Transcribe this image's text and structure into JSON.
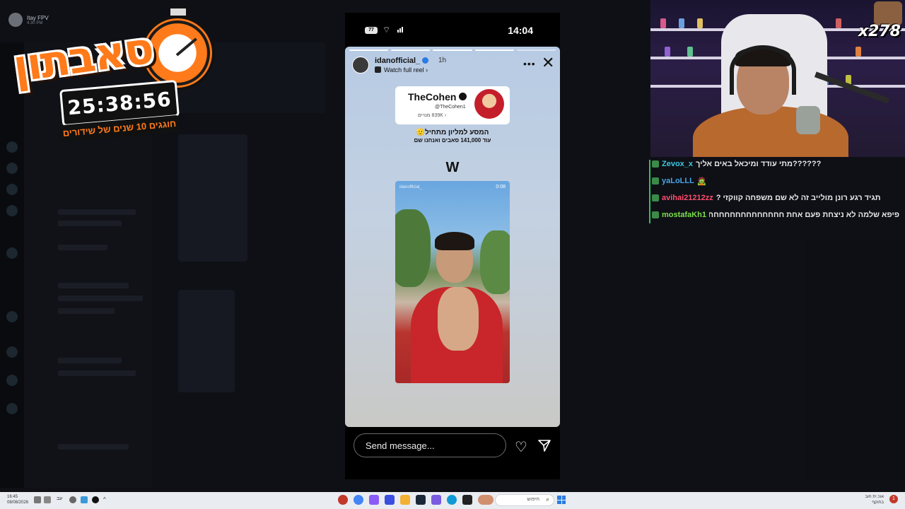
{
  "overlay": {
    "streamer_name": "Itay",
    "streamer_badge": "FPV",
    "streamer_sub": "4:30 PM",
    "logo_title": "סאבתון",
    "timer": "25:38:56",
    "logo_subtitle": "חוגגים 10 שנים של שידורים",
    "counter": "x278"
  },
  "phone": {
    "status": {
      "battery": "77",
      "clock": "14:04"
    },
    "story": {
      "username": "idanofficial_",
      "time_ago": "1h",
      "watch_reel": "Watch full reel ›",
      "card": {
        "name": "TheCohen",
        "handle": "@TheCohen1",
        "subs": "‹ 839K מנויים"
      },
      "line1": "המסע למליון מתחיל🫡",
      "line2": "עוד 141,000 סאבים ואנחנו שם",
      "big_letter": "W",
      "reel_user": "idanofficial_",
      "reel_time": "0:08"
    },
    "message_placeholder": "Send message..."
  },
  "chat": {
    "messages": [
      {
        "user": "Zevox_x",
        "color": "#3ec6e0",
        "text": "??????מתי עודד ומיכאל באים אליך"
      },
      {
        "user": "yaLoLLL",
        "color": "#4aa3e8",
        "text": "🧟"
      },
      {
        "user": "avihai21212zz",
        "color": "#ff4d6d",
        "text": "תגיד רגע רונן מולייב זה לא שם משפחה קווקזי ?"
      },
      {
        "user": "mostafaKh1",
        "color": "#7be04a",
        "text": "פיפא שלמה לא ניצחת פעם אחת חחחחחחחחחחחחחח"
      }
    ]
  },
  "taskbar": {
    "time": "16:45",
    "date": "08/08/2026",
    "lang": "עב",
    "search_text": "חיפוש",
    "notif_line1": "אוכ.ית חוב",
    "notif_line2": "בתוקף",
    "badge": "1"
  }
}
